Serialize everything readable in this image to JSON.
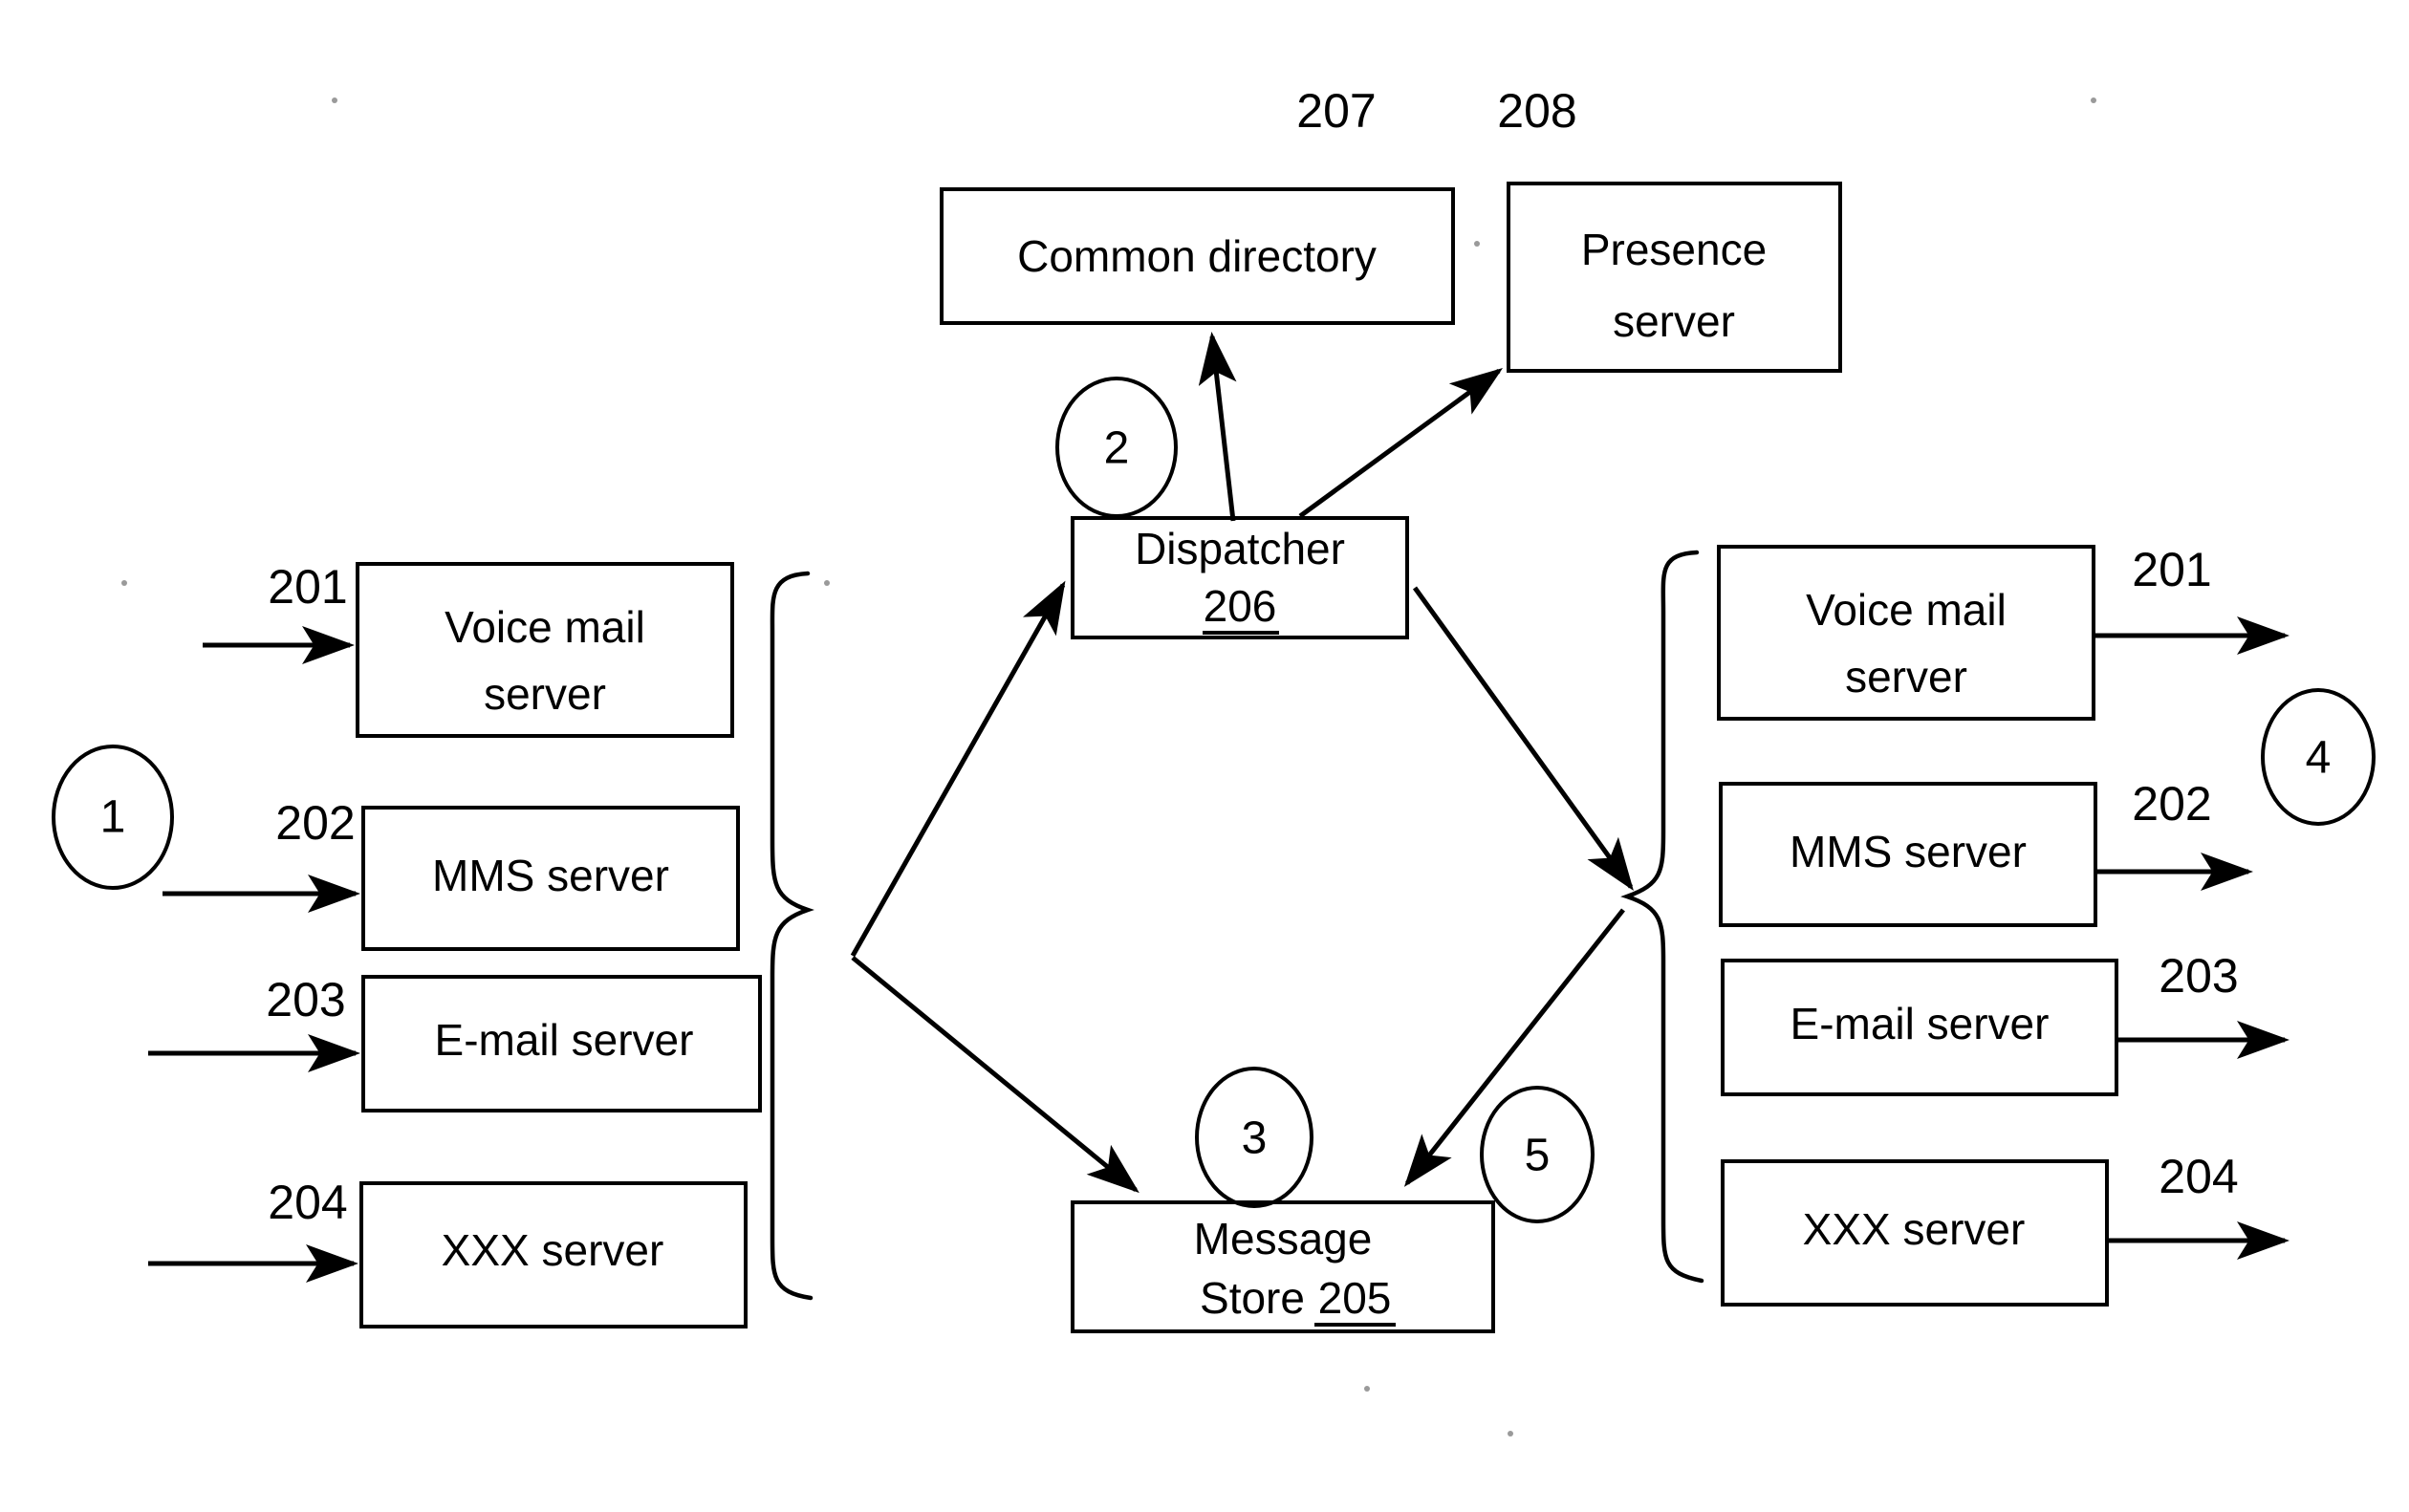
{
  "figure": {
    "title": "Messaging system architecture block diagram",
    "background_color": "#ffffff",
    "line_color": "#000000"
  },
  "boxes": {
    "common_directory": {
      "label": "Common directory",
      "ref": "207"
    },
    "presence_server": {
      "label_line1": "Presence",
      "label_line2": "server",
      "ref": "208"
    },
    "dispatcher": {
      "label": "Dispatcher",
      "ref": "206"
    },
    "message_store": {
      "label_line1": "Message",
      "label_line2": "Store",
      "ref": "205"
    }
  },
  "left_servers": [
    {
      "label_line1": "Voice mail",
      "label_line2": "server",
      "ref": "201"
    },
    {
      "label_line1": "MMS server",
      "label_line2": "",
      "ref": "202"
    },
    {
      "label_line1": "E-mail server",
      "label_line2": "",
      "ref": "203"
    },
    {
      "label_line1": "XXX server",
      "label_line2": "",
      "ref": "204"
    }
  ],
  "right_servers": [
    {
      "label_line1": "Voice mail",
      "label_line2": "server",
      "ref": "201"
    },
    {
      "label_line1": "MMS server",
      "label_line2": "",
      "ref": "202"
    },
    {
      "label_line1": "E-mail server",
      "label_line2": "",
      "ref": "203"
    },
    {
      "label_line1": "XXX server",
      "label_line2": "",
      "ref": "204"
    }
  ],
  "step_markers": [
    {
      "id": "step-1",
      "label": "1"
    },
    {
      "id": "step-2",
      "label": "2"
    },
    {
      "id": "step-3",
      "label": "3"
    },
    {
      "id": "step-4",
      "label": "4"
    },
    {
      "id": "step-5",
      "label": "5"
    }
  ]
}
